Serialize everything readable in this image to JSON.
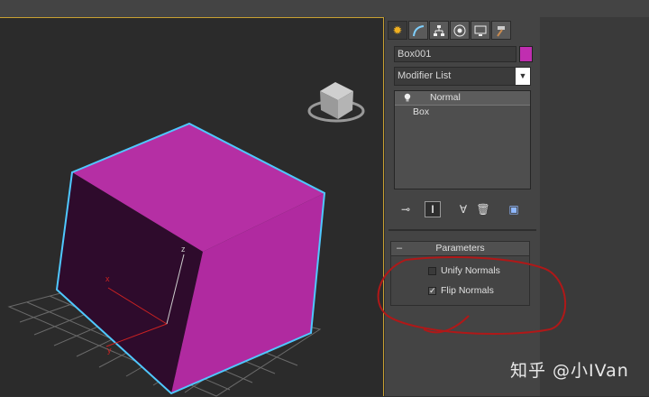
{
  "command_panel": {
    "tabs": [
      {
        "name": "create-tab",
        "icon": "sun-icon"
      },
      {
        "name": "modify-tab",
        "icon": "modify-curve-icon"
      },
      {
        "name": "hierarchy-tab",
        "icon": "hierarchy-icon"
      },
      {
        "name": "motion-tab",
        "icon": "motion-icon"
      },
      {
        "name": "display-tab",
        "icon": "display-monitor-icon"
      },
      {
        "name": "utilities-tab",
        "icon": "hammer-icon"
      }
    ],
    "object_name": "Box001",
    "object_color": "#c02eb0",
    "modifier_list_label": "Modifier List",
    "stack": [
      {
        "label": "Normal",
        "selected": true,
        "icon": "lightbulb-icon"
      },
      {
        "label": "Box",
        "selected": false
      }
    ]
  },
  "parameters": {
    "title": "Parameters",
    "collapse_symbol": "–",
    "unify_normals": {
      "label": "Unify Normals",
      "checked": false
    },
    "flip_normals": {
      "label": "Flip Normals",
      "checked": true
    }
  },
  "viewport": {
    "axis_labels": {
      "x": "x",
      "y": "y",
      "z": "z"
    },
    "viewcube_icon": "viewcube-icon"
  },
  "watermark": "知乎 @小IVan",
  "colors": {
    "accent_border": "#c8a032",
    "selection_outline": "#4fc8ff",
    "annotation_red": "#b01818"
  }
}
